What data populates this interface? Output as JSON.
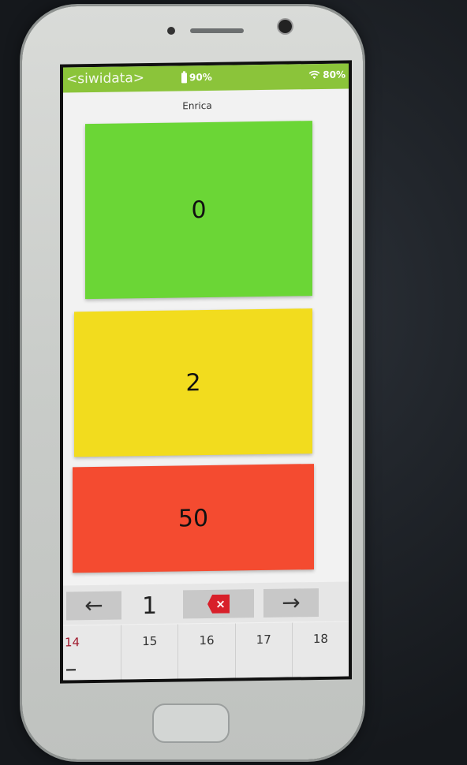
{
  "statusbar": {
    "app_title": "<siwidata>",
    "battery": "90%",
    "wifi": "80%"
  },
  "user": {
    "name": "Enrica"
  },
  "tiles": [
    {
      "value": "0",
      "color": "#6bd636"
    },
    {
      "value": "2",
      "color": "#f2dc1e"
    },
    {
      "value": "50",
      "color": "#f44b30"
    }
  ],
  "navbar": {
    "prev_icon": "←",
    "page_number": "1",
    "clear_icon": "×",
    "next_icon": "→"
  },
  "days": [
    "14",
    "15",
    "16",
    "17",
    "18"
  ],
  "colors": {
    "statusbar": "#8bc43a",
    "active_day": "#a0182c",
    "clear_button": "#d8202a"
  }
}
